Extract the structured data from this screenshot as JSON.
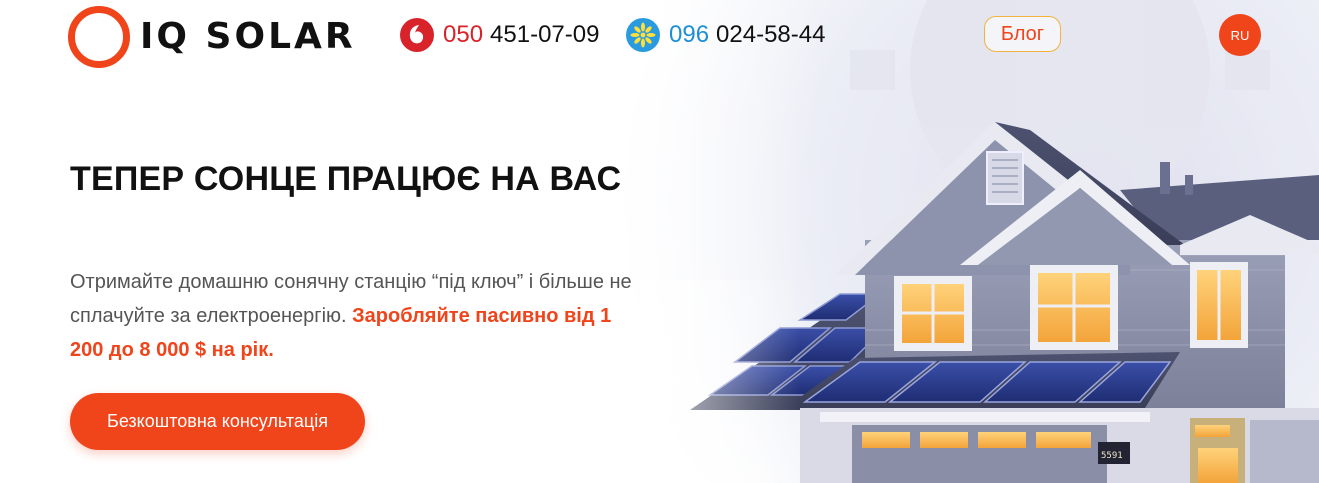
{
  "header": {
    "logo_text": "IQ SOLAR",
    "phones": [
      {
        "operator": "vodafone-icon",
        "code": "050",
        "number": "451-07-09"
      },
      {
        "operator": "kyivstar-icon",
        "code": "096",
        "number": "024-58-44"
      }
    ],
    "blog_label": "Блог",
    "lang_label": "RU"
  },
  "hero": {
    "title": "ТЕПЕР СОНЦЕ ПРАЦЮЄ НА ВАС",
    "description_plain": "Отримайте домашню сонячну станцію “під ключ” і більше не сплачуйте за електроенергію.",
    "description_accent": "Заробляйте пасивно від 1 200 до 8 000 $ на рік.",
    "cta_label": "Безкоштовна консультація",
    "house_number": "5591"
  },
  "colors": {
    "accent": "#f0441b",
    "vodafone": "#d8232a",
    "kyivstar": "#1e8fd6",
    "blog_border": "#f2b43c"
  }
}
